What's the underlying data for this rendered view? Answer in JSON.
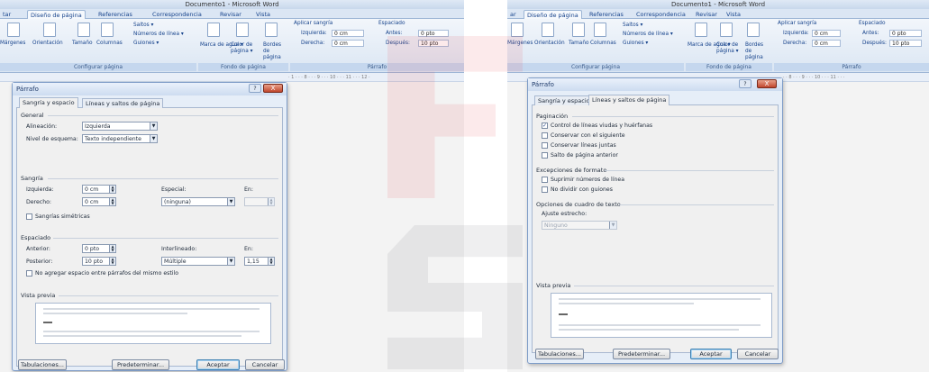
{
  "left": {
    "window_title": "Documento1 - Microsoft Word",
    "tabs": [
      "tar",
      "Diseño de página",
      "Referencias",
      "Correspondencia",
      "Revisar",
      "Vista"
    ],
    "ribbon": {
      "margenes": "Márgenes",
      "orientacion": "Orientación",
      "tamano": "Tamaño",
      "columnas": "Columnas",
      "saltos": "Saltos ▾",
      "numeros_linea": "Números de línea ▾",
      "guiones": "Guiones ▾",
      "group_config": "Configurar página",
      "marca_agua": "Marca de agua ▾",
      "color_pagina": "Color de página ▾",
      "bordes_pagina": "Bordes de página",
      "group_fondo": "Fondo de página",
      "aplicar_sangria": "Aplicar sangría",
      "izquierda_lbl": "Izquierda:",
      "izquierda_val": "0 cm",
      "derecha_lbl": "Derecha:",
      "derecha_val": "0 cm",
      "espaciado": "Espaciado",
      "antes_lbl": "Antes:",
      "antes_val": "0 pto",
      "despues_lbl": "Después:",
      "despues_val": "10 pto",
      "group_parrafo": "Párrafo"
    },
    "ruler": "· 1 · · · 8 · · · 9 · · · 10 · · · 11 · · · 12 ·",
    "dialog": {
      "title": "Párrafo",
      "help": "?",
      "close": "X",
      "tab1": "Sangría y espacio",
      "tab2": "Líneas y saltos de página",
      "general": "General",
      "alineacion_lbl": "Alineación:",
      "alineacion_val": "Izquierda",
      "nivel_lbl": "Nivel de esquema:",
      "nivel_val": "Texto independiente",
      "sangria": "Sangría",
      "izquierda_lbl": "Izquierda:",
      "izquierda_val": "0 cm",
      "derecha_lbl": "Derecho:",
      "derecha_val": "0 cm",
      "especial_lbl": "Especial:",
      "especial_val": "(ninguna)",
      "en_lbl": "En:",
      "simetricas": "Sangrías simétricas",
      "espaciado": "Espaciado",
      "anterior_lbl": "Anterior:",
      "anterior_val": "0 pto",
      "posterior_lbl": "Posterior:",
      "posterior_val": "10 pto",
      "interlineado_lbl": "Interlineado:",
      "interlineado_val": "Múltiple",
      "en2_lbl": "En:",
      "en2_val": "1,15",
      "no_agregar": "No agregar espacio entre párrafos del mismo estilo",
      "vista_previa": "Vista previa",
      "tabulaciones": "Tabulaciones...",
      "predeterminar": "Predeterminar...",
      "aceptar": "Aceptar",
      "cancelar": "Cancelar"
    }
  },
  "right": {
    "window_title": "Documento1 - Microsoft Word",
    "tabs": [
      "ar",
      "Diseño de página",
      "Referencias",
      "Correspondencia",
      "Revisar",
      "Vista"
    ],
    "ribbon": {
      "margenes": "Márgenes",
      "orientacion": "Orientación",
      "tamano": "Tamaño",
      "columnas": "Columnas",
      "saltos": "Saltos ▾",
      "numeros_linea": "Números de línea ▾",
      "guiones": "Guiones ▾",
      "group_config": "Configurar página",
      "marca_agua": "Marca de agua ▾",
      "color_pagina": "Color de página ▾",
      "bordes_pagina": "Bordes de página",
      "group_fondo": "Fondo de página",
      "aplicar_sangria": "Aplicar sangría",
      "izquierda_lbl": "Izquierda:",
      "izquierda_val": "0 cm",
      "derecha_lbl": "Derecha:",
      "derecha_val": "0 cm",
      "espaciado": "Espaciado",
      "antes_lbl": "Antes:",
      "antes_val": "0 pto",
      "despues_lbl": "Después:",
      "despues_val": "10 pto",
      "group_parrafo": "Párrafo"
    },
    "ruler": "· · 8 · · · 9 · · · 10 · · · 11 · · ·",
    "dialog": {
      "title": "Párrafo",
      "help": "?",
      "close": "X",
      "tab1": "Sangría y espacio",
      "tab2": "Líneas y saltos de página",
      "paginacion": "Paginación",
      "control_viudas": "Control de líneas viudas y huérfanas",
      "conservar_siguiente": "Conservar con el siguiente",
      "conservar_juntas": "Conservar líneas juntas",
      "salto_pagina": "Salto de página anterior",
      "excepciones": "Excepciones de formato",
      "suprimir": "Suprimir números de línea",
      "no_dividir": "No dividir con guiones",
      "opciones_cuadro": "Opciones de cuadro de texto",
      "ajuste_lbl": "Ajuste estrecho:",
      "ajuste_val": "Ninguno",
      "vista_previa": "Vista previa",
      "tabulaciones": "Tabulaciones...",
      "predeterminar": "Predeterminar...",
      "aceptar": "Aceptar",
      "cancelar": "Cancelar"
    }
  },
  "colors": {
    "ribbon": "#dbe6f4",
    "dialog": "#e6eef8",
    "close": "#c1462c",
    "watermark_red": "#e8565a"
  }
}
